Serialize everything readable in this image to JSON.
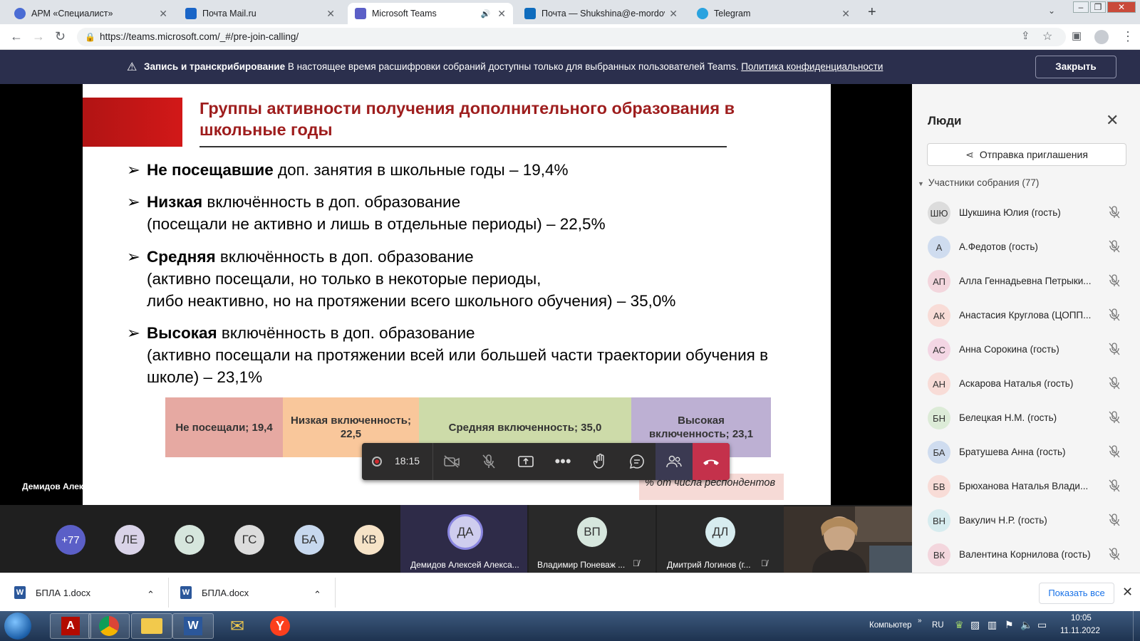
{
  "browser": {
    "tabs": [
      {
        "title": "АРМ «Специалист»",
        "favicon_color": "#4a6cd4"
      },
      {
        "title": "Почта Mail.ru",
        "favicon_color": "#1a65c7"
      },
      {
        "title": "Microsoft Teams",
        "favicon_color": "#5b5fc7",
        "active": true
      },
      {
        "title": "Почта — Shukshina@e-mordovia",
        "favicon_color": "#0f6cbd"
      },
      {
        "title": "Telegram",
        "favicon_color": "#2aa3df"
      }
    ],
    "url": "https://teams.microsoft.com/_#/pre-join-calling/"
  },
  "banner": {
    "bold": "Запись и транскрибирование",
    "text": "В настоящее время расшифровки собраний доступны только для выбранных пользователей Teams.",
    "link": "Политика конфиденциальности",
    "close_label": "Закрыть"
  },
  "slide": {
    "title": "Группы активности получения дополнительного образования в школьные годы",
    "bullets": [
      {
        "bold": "Не посещавшие",
        "lines": [
          " доп. занятия в школьные годы – 19,4%"
        ]
      },
      {
        "bold": "Низкая",
        "lines": [
          " включённость в доп. образование",
          "(посещали не активно и лишь в отдельные периоды) – 22,5%"
        ]
      },
      {
        "bold": "Средняя",
        "lines": [
          " включённость в доп. образование",
          "(активно посещали, но только в некоторые периоды,",
          "либо неактивно, но на протяжении всего школьного обучения) – 35,0%"
        ]
      },
      {
        "bold": "Высокая",
        "lines": [
          "  включённость в доп. образование",
          "(активно посещали на протяжении всей или большей части траектории обучения в",
          "школе) – 23,1%"
        ]
      }
    ],
    "note": "% от числа респондентов"
  },
  "chart_data": {
    "type": "bar",
    "orientation": "horizontal-stacked",
    "categories": [
      "Не посещали",
      "Низкая включенность",
      "Средняя включенность",
      "Высокая включенность"
    ],
    "values": [
      19.4,
      22.5,
      35.0,
      23.1
    ],
    "labels": [
      "Не посещали; 19,4",
      "Низкая включенность; 22,5",
      "Средняя включенность; 35,0",
      "Высокая включенность; 23,1"
    ],
    "colors": [
      "#e6a9a2",
      "#f9c79b",
      "#cddba9",
      "#bdb0d3"
    ]
  },
  "speaker_name": "Демидов Алексей Александрович",
  "callbar": {
    "time": "18:15"
  },
  "strip": {
    "more_count": "+77",
    "avatars": [
      {
        "initials": "ЛЕ",
        "color": "#d9d3e8"
      },
      {
        "initials": "О",
        "color": "#d6e6dd"
      },
      {
        "initials": "ГС",
        "color": "#dcdcdc"
      },
      {
        "initials": "БА",
        "color": "#c7d8ee"
      },
      {
        "initials": "КВ",
        "color": "#f6e3c7"
      }
    ],
    "tiles": [
      {
        "initials": "ДА",
        "name": "Демидов Алексей Алекса...",
        "color": "#cfcdee"
      },
      {
        "initials": "ВП",
        "name": "Владимир Поневаж ...",
        "color": "#d6e6dd"
      },
      {
        "initials": "ДЛ",
        "name": "Дмитрий Логинов (г...",
        "color": "#d7ecef"
      }
    ]
  },
  "panel": {
    "title": "Люди",
    "invite_label": "Отправка приглашения",
    "section_label": "Участники собрания (77)",
    "participants": [
      {
        "initials": "ШЮ",
        "name": "Шукшина Юлия (гость)",
        "color": "#dcdcdc"
      },
      {
        "initials": "А",
        "name": "А.Федотов (гость)",
        "color": "#cfdcef"
      },
      {
        "initials": "АП",
        "name": "Алла Геннадьевна Петрыки...",
        "color": "#f3d6dd"
      },
      {
        "initials": "АК",
        "name": "Анастасия Круглова (ЦОПП...",
        "color": "#f8dcd7"
      },
      {
        "initials": "АС",
        "name": "Анна Сорокина (гость)",
        "color": "#f3d6e4"
      },
      {
        "initials": "АН",
        "name": "Аскарова Наталья (гость)",
        "color": "#f8dcd7"
      },
      {
        "initials": "БН",
        "name": "Белецкая Н.М. (гость)",
        "color": "#dcebd7"
      },
      {
        "initials": "БА",
        "name": "Братушева Анна (гость)",
        "color": "#cfdcef"
      },
      {
        "initials": "БВ",
        "name": "Брюханова Наталья Влади...",
        "color": "#f8dcd7"
      },
      {
        "initials": "ВН",
        "name": "Вакулич Н.Р. (гость)",
        "color": "#d7ecef"
      },
      {
        "initials": "ВК",
        "name": "Валентина Корнилова (гость)",
        "color": "#f3d6dd"
      }
    ]
  },
  "downloads": [
    {
      "name": "БПЛА 1.docx"
    },
    {
      "name": "БПЛА.docx"
    }
  ],
  "downloads_show_all": "Показать все",
  "tray": {
    "computer": "Компьютер",
    "lang": "RU",
    "time": "10:05",
    "date": "11.11.2022"
  }
}
